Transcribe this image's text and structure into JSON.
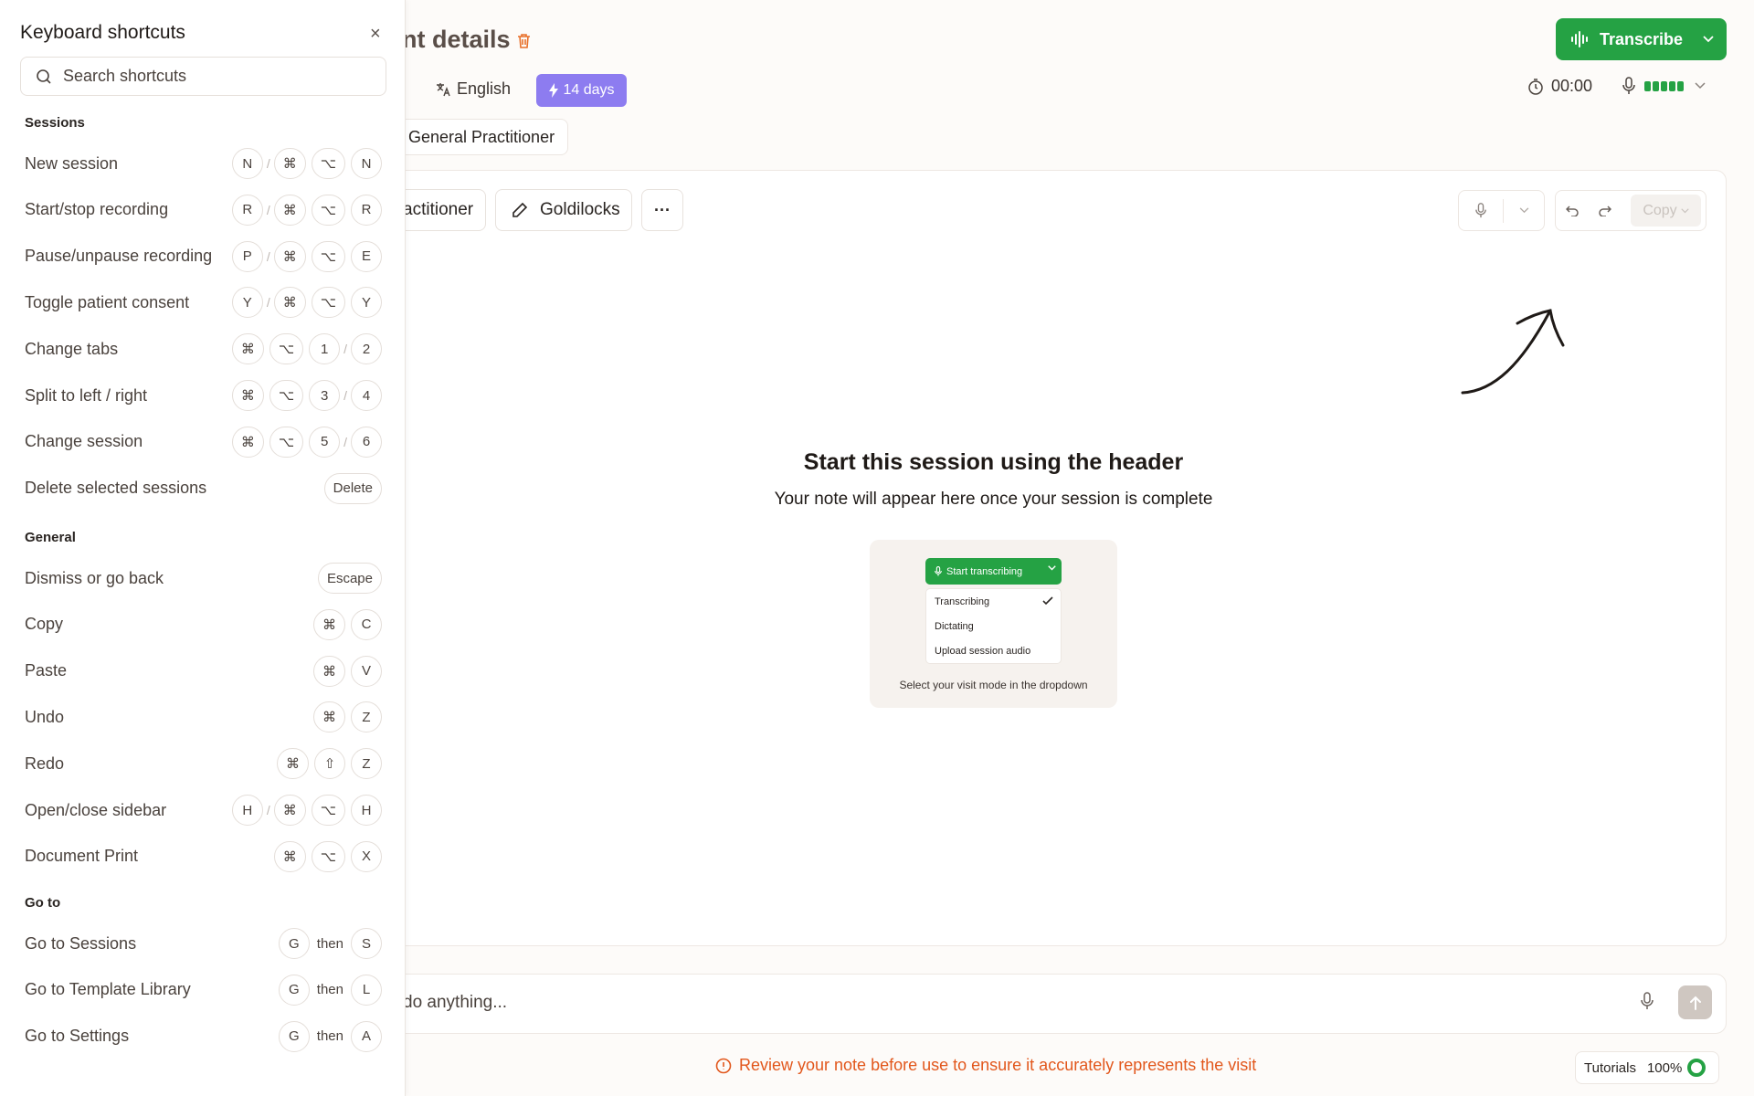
{
  "header": {
    "title_fragment": "nt details",
    "transcribe_label": "Transcribe",
    "language": "English",
    "days_badge": "14 days",
    "timer": "00:00",
    "template_tag": "General Practitioner"
  },
  "toolbar": {
    "chip_practitioner": "actitioner",
    "chip_goldilocks": "Goldilocks",
    "chip_more": "···",
    "copy_label": "Copy"
  },
  "empty_state": {
    "title": "Start this session using the header",
    "subtitle": "Your note will appear here once your session is complete",
    "illustration": {
      "button": "Start transcribing",
      "options": [
        "Transcribing",
        "Dictating",
        "Upload session audio"
      ],
      "caption": "Select your visit mode in the dropdown"
    }
  },
  "input_bar": {
    "text": "do anything..."
  },
  "footer": {
    "warning": "Review your note before use to ensure it accurately represents the visit",
    "tutorials": "Tutorials",
    "progress_label": "100%",
    "progress_value": 1.0
  },
  "shortcuts": {
    "title": "Keyboard shortcuts",
    "close": "×",
    "search_placeholder": "Search shortcuts",
    "sections": [
      {
        "name": "Sessions",
        "items": [
          {
            "label": "New session",
            "keys": [
              "N",
              "/",
              "⌘",
              "⌥",
              "N"
            ]
          },
          {
            "label": "Start/stop recording",
            "keys": [
              "R",
              "/",
              "⌘",
              "⌥",
              "R"
            ]
          },
          {
            "label": "Pause/unpause recording",
            "keys": [
              "P",
              "/",
              "⌘",
              "⌥",
              "E"
            ]
          },
          {
            "label": "Toggle patient consent",
            "keys": [
              "Y",
              "/",
              "⌘",
              "⌥",
              "Y"
            ]
          },
          {
            "label": "Change tabs",
            "keys": [
              "⌘",
              "⌥",
              "1",
              "/",
              "2"
            ]
          },
          {
            "label": "Split to left / right",
            "keys": [
              "⌘",
              "⌥",
              "3",
              "/",
              "4"
            ]
          },
          {
            "label": "Change session",
            "keys": [
              "⌘",
              "⌥",
              "5",
              "/",
              "6"
            ]
          },
          {
            "label": "Delete selected sessions",
            "keys": [
              "Delete"
            ]
          }
        ]
      },
      {
        "name": "General",
        "items": [
          {
            "label": "Dismiss or go back",
            "keys": [
              "Escape"
            ]
          },
          {
            "label": "Copy",
            "keys": [
              "⌘",
              "C"
            ]
          },
          {
            "label": "Paste",
            "keys": [
              "⌘",
              "V"
            ]
          },
          {
            "label": "Undo",
            "keys": [
              "⌘",
              "Z"
            ]
          },
          {
            "label": "Redo",
            "keys": [
              "⌘",
              "⇧",
              "Z"
            ]
          },
          {
            "label": "Open/close sidebar",
            "keys": [
              "H",
              "/",
              "⌘",
              "⌥",
              "H"
            ]
          },
          {
            "label": "Document Print",
            "keys": [
              "⌘",
              "⌥",
              "X"
            ]
          }
        ]
      },
      {
        "name": "Go to",
        "items": [
          {
            "label": "Go to Sessions",
            "keys": [
              "G",
              "then",
              "S"
            ]
          },
          {
            "label": "Go to Template Library",
            "keys": [
              "G",
              "then",
              "L"
            ]
          },
          {
            "label": "Go to Settings",
            "keys": [
              "G",
              "then",
              "A"
            ]
          }
        ]
      }
    ]
  },
  "colors": {
    "accent_green": "#25a244",
    "badge_purple": "#8d7cf0",
    "warning_orange": "#e2571c",
    "delete_orange": "#e8702a"
  },
  "icons": [
    "trash-icon",
    "waveform-icon",
    "translate-icon",
    "bolt-icon",
    "timer-icon",
    "mic-icon",
    "chevron-down-icon",
    "pencil-icon",
    "undo-icon",
    "redo-icon",
    "send-icon",
    "alert-icon",
    "search-icon",
    "check-icon",
    "close-icon"
  ]
}
